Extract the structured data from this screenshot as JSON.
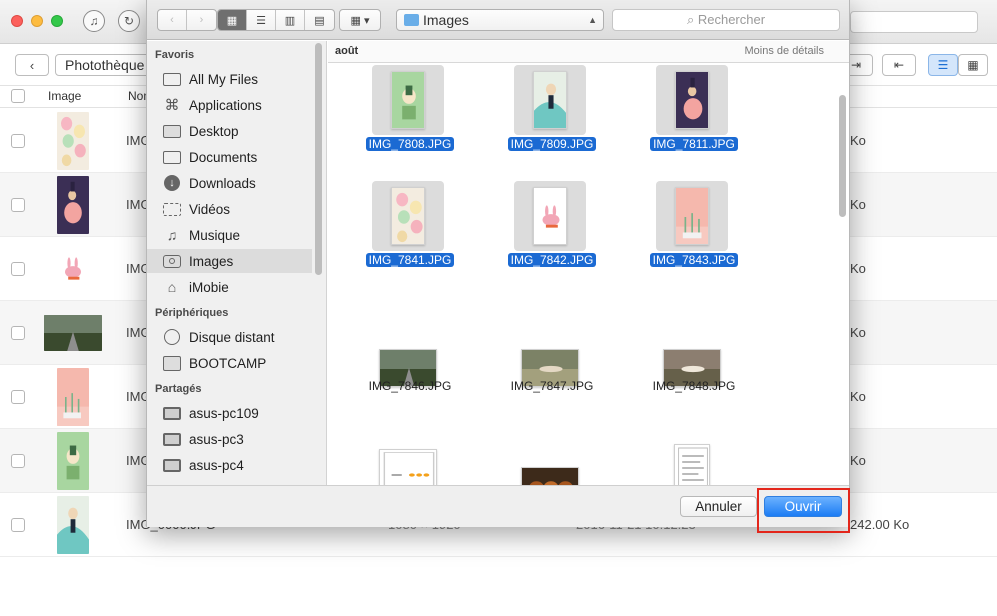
{
  "app": {
    "library_select": "Photothèque (",
    "table_headers": {
      "image": "Image",
      "name": "Nom"
    },
    "rows": [
      {
        "name": "IMG",
        "size": "Ko",
        "thumb": "macarons"
      },
      {
        "name": "IMG",
        "size": "Ko",
        "thumb": "girl-dark"
      },
      {
        "name": "IMG",
        "size": "Ko",
        "thumb": "bunny"
      },
      {
        "name": "IMG",
        "size": "Ko",
        "thumb": "road"
      },
      {
        "name": "IMG",
        "size": "Ko",
        "thumb": "pink-plants"
      },
      {
        "name": "IMG",
        "size": "Ko",
        "thumb": "green-cactus"
      },
      {
        "name": "IMG_0000.JPG",
        "size": "242.00 Ko",
        "dims": "1080 × 1920",
        "date": "2016-11-21 10:12:23",
        "thumb": "girl-mint"
      }
    ]
  },
  "dialog": {
    "location": "Images",
    "search_placeholder": "Rechercher",
    "sidebar": {
      "sections": [
        {
          "title": "Favoris",
          "items": [
            {
              "label": "All My Files",
              "icon": "all-files-icon"
            },
            {
              "label": "Applications",
              "icon": "applications-icon"
            },
            {
              "label": "Desktop",
              "icon": "desktop-icon"
            },
            {
              "label": "Documents",
              "icon": "documents-icon"
            },
            {
              "label": "Downloads",
              "icon": "downloads-icon"
            },
            {
              "label": "Vidéos",
              "icon": "videos-icon"
            },
            {
              "label": "Musique",
              "icon": "music-icon"
            },
            {
              "label": "Images",
              "icon": "camera-icon",
              "selected": true
            },
            {
              "label": "iMobie",
              "icon": "home-icon"
            }
          ]
        },
        {
          "title": "Périphériques",
          "items": [
            {
              "label": "Disque distant",
              "icon": "remote-disc-icon"
            },
            {
              "label": "BOOTCAMP",
              "icon": "drive-icon"
            }
          ]
        },
        {
          "title": "Partagés",
          "items": [
            {
              "label": "asus-pc109",
              "icon": "computer-icon"
            },
            {
              "label": "asus-pc3",
              "icon": "computer-icon"
            },
            {
              "label": "asus-pc4",
              "icon": "computer-icon"
            }
          ]
        }
      ]
    },
    "group_label": "août",
    "less_details": "Moins de détails",
    "files": [
      {
        "name": "IMG_7808.JPG",
        "selected": true,
        "thumb": "green-cactus"
      },
      {
        "name": "IMG_7809.JPG",
        "selected": true,
        "thumb": "girl-mint"
      },
      {
        "name": "IMG_7811.JPG",
        "selected": true,
        "thumb": "girl-dark"
      },
      {
        "name": "IMG_7841.JPG",
        "selected": true,
        "thumb": "macarons"
      },
      {
        "name": "IMG_7842.JPG",
        "selected": true,
        "thumb": "bunny"
      },
      {
        "name": "IMG_7843.JPG",
        "selected": true,
        "thumb": "pink-plants"
      },
      {
        "name": "IMG_7846.JPG",
        "selected": false,
        "thumb": "road"
      },
      {
        "name": "IMG_7847.JPG",
        "selected": false,
        "thumb": "duck"
      },
      {
        "name": "IMG_7848.JPG",
        "selected": false,
        "thumb": "duck2"
      },
      {
        "name": "",
        "selected": false,
        "thumb": "stars"
      },
      {
        "name": "",
        "selected": false,
        "thumb": "ducks-crowd"
      },
      {
        "name": "",
        "selected": false,
        "thumb": "document"
      }
    ],
    "cancel_label": "Annuler",
    "open_label": "Ouvrir",
    "colors": {
      "selection": "#1b6ad3",
      "primary_button": "#1c7cf4",
      "highlight": "#e3261b"
    }
  }
}
